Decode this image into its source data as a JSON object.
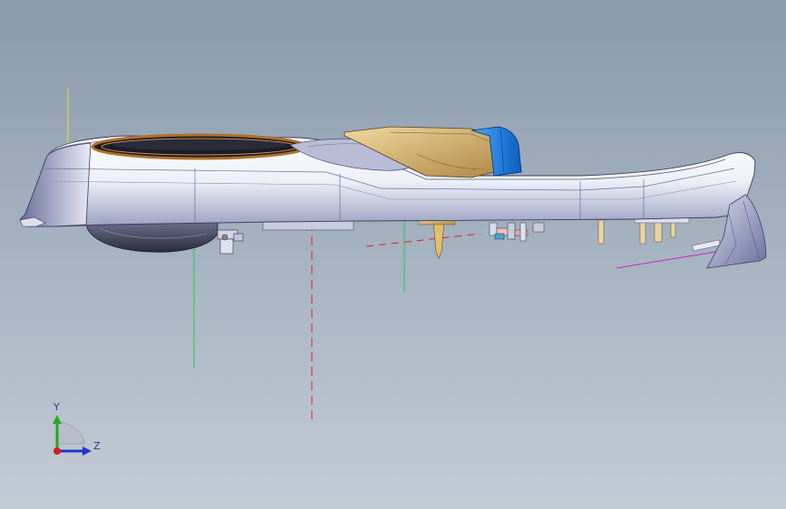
{
  "viewport": {
    "background_top": "#8a9aac",
    "background_bottom": "#c3cbd5"
  },
  "triad": {
    "y_label": "Y",
    "z_label": "Z",
    "y_color": "#22aa22",
    "z_color": "#2233cc",
    "x_color": "#cc2222"
  },
  "reference_lines": {
    "yellow": "#e8e020",
    "green": "#22cc44",
    "red_dashed": "#dd2222",
    "magenta": "#cc22cc"
  },
  "model": {
    "body_color": "#f4f4fa",
    "shade_color": "#7a7fa8",
    "gold_color": "#d8b878",
    "blue_accent": "#1e7ee0",
    "copper_coil": "#b0702a"
  }
}
